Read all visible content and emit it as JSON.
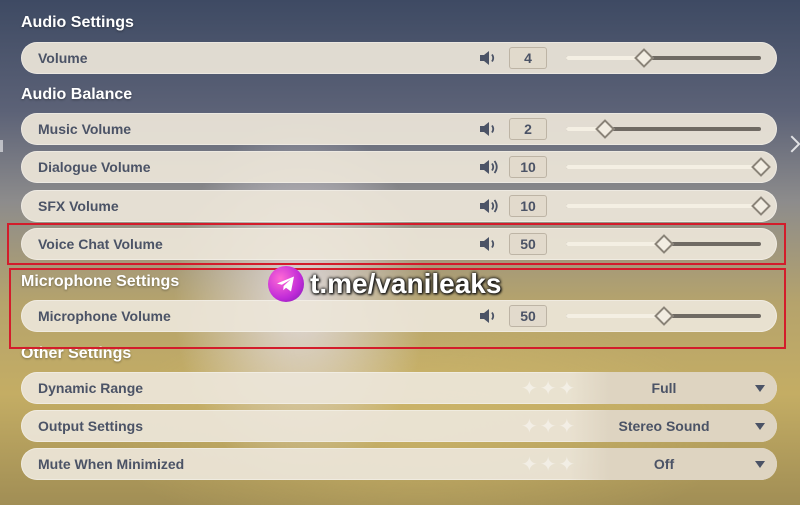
{
  "sections": {
    "audio_settings": "Audio Settings",
    "audio_balance": "Audio Balance",
    "microphone_settings": "Microphone Settings",
    "other_settings": "Other Settings"
  },
  "sliders": {
    "volume": {
      "label": "Volume",
      "value": "4",
      "level": 0.4
    },
    "music": {
      "label": "Music Volume",
      "value": "2",
      "level": 0.2
    },
    "dialogue": {
      "label": "Dialogue Volume",
      "value": "10",
      "level": 1.0
    },
    "sfx": {
      "label": "SFX Volume",
      "value": "10",
      "level": 1.0
    },
    "voice_chat": {
      "label": "Voice Chat Volume",
      "value": "50",
      "level": 0.5
    },
    "microphone": {
      "label": "Microphone Volume",
      "value": "50",
      "level": 0.5
    }
  },
  "dropdowns": {
    "dynamic_range": {
      "label": "Dynamic Range",
      "value": "Full"
    },
    "output_settings": {
      "label": "Output Settings",
      "value": "Stereo Sound"
    },
    "mute_minimized": {
      "label": "Mute When Minimized",
      "value": "Off"
    }
  },
  "watermark": {
    "text": "t.me/vanileaks",
    "icon": "telegram-icon"
  },
  "colors": {
    "highlight": "#d31c2b",
    "row_bg": "#ece5d8",
    "text": "#4b5366"
  }
}
